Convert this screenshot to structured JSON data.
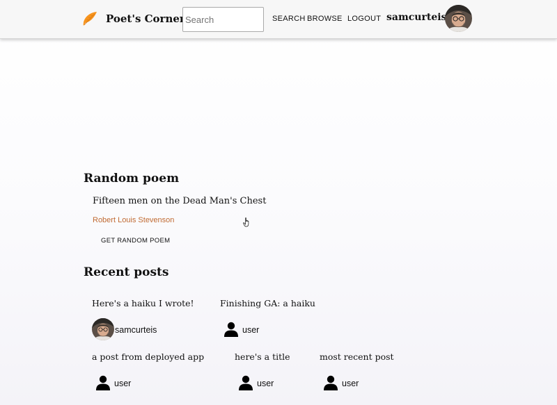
{
  "header": {
    "brand": "Poet's Corner",
    "search_placeholder": "Search",
    "nav": {
      "search": "SEARCH",
      "browse": "BROWSE",
      "logout": "LOGOUT"
    },
    "username": "samcurteis",
    "icons": {
      "logo": "feather-icon",
      "avatar": "avatar"
    }
  },
  "random_poem": {
    "heading": "Random poem",
    "title": "Fifteen men on the Dead Man's Chest",
    "author": "Robert Louis Stevenson",
    "button": "GET RANDOM POEM"
  },
  "recent_posts": {
    "heading": "Recent posts",
    "posts": [
      {
        "title": "Here's a haiku I wrote!",
        "author": "samcurteis",
        "icon": "avatar"
      },
      {
        "title": "Finishing GA: a haiku",
        "author": "user",
        "icon": "user-icon"
      },
      {
        "title": "a post from deployed app",
        "author": "user",
        "icon": "user-icon"
      },
      {
        "title": "here's a title",
        "author": "user",
        "icon": "user-icon"
      },
      {
        "title": "most recent post",
        "author": "user",
        "icon": "user-icon"
      }
    ]
  },
  "colors": {
    "accent": "#c06a32",
    "logo": "#f7941d",
    "navbar_bg": "#f7f7f7"
  }
}
